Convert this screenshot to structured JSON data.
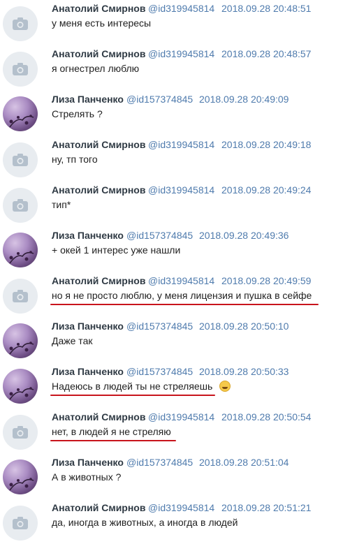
{
  "messages": [
    {
      "author": "Анатолий Смирнов",
      "handle": "@id319945814",
      "time": "2018.09.28 20:48:51",
      "text": "у меня есть интересы",
      "avatar": "camera-placeholder"
    },
    {
      "author": "Анатолий Смирнов",
      "handle": "@id319945814",
      "time": "2018.09.28 20:48:57",
      "text": "я огнестрел люблю",
      "avatar": "camera-placeholder"
    },
    {
      "author": "Лиза Панченко",
      "handle": "@id157374845",
      "time": "2018.09.28 20:49:09",
      "text": "Стрелять ?",
      "avatar": "photo"
    },
    {
      "author": "Анатолий Смирнов",
      "handle": "@id319945814",
      "time": "2018.09.28 20:49:18",
      "text": "ну, тп того",
      "avatar": "camera-placeholder"
    },
    {
      "author": "Анатолий Смирнов",
      "handle": "@id319945814",
      "time": "2018.09.28 20:49:24",
      "text": "тип*",
      "avatar": "camera-placeholder"
    },
    {
      "author": "Лиза Панченко",
      "handle": "@id157374845",
      "time": "2018.09.28 20:49:36",
      "text": "+ окей 1 интерес уже нашли",
      "avatar": "photo"
    },
    {
      "author": "Анатолий Смирнов",
      "handle": "@id319945814",
      "time": "2018.09.28 20:49:59",
      "text": "но я не просто люблю, у меня лицензия и пушка в сейфе",
      "avatar": "camera-placeholder",
      "underlined": true
    },
    {
      "author": "Лиза Панченко",
      "handle": "@id157374845",
      "time": "2018.09.28 20:50:10",
      "text": "Даже так",
      "avatar": "photo"
    },
    {
      "author": "Лиза Панченко",
      "handle": "@id157374845",
      "time": "2018.09.28 20:50:33",
      "text": "Надеюсь в людей ты не стреляешь",
      "avatar": "photo",
      "underlined": true,
      "emoji": "grinning-sweat-emoji"
    },
    {
      "author": "Анатолий Смирнов",
      "handle": "@id319945814",
      "time": "2018.09.28 20:50:54",
      "text": "нет, в людей я не стреляю",
      "avatar": "camera-placeholder",
      "underlined": true
    },
    {
      "author": "Лиза Панченко",
      "handle": "@id157374845",
      "time": "2018.09.28 20:51:04",
      "text": "А в животных ?",
      "avatar": "photo"
    },
    {
      "author": "Анатолий Смирнов",
      "handle": "@id319945814",
      "time": "2018.09.28 20:51:21",
      "text": "да, иногда в животных, а иногда в людей",
      "avatar": "camera-placeholder"
    }
  ],
  "colors": {
    "name": "#2f3a44",
    "handle": "#4f7bad",
    "text": "#1f1f1f",
    "underline": "#c8141c",
    "placeholder_bg": "#e8ecf0"
  }
}
